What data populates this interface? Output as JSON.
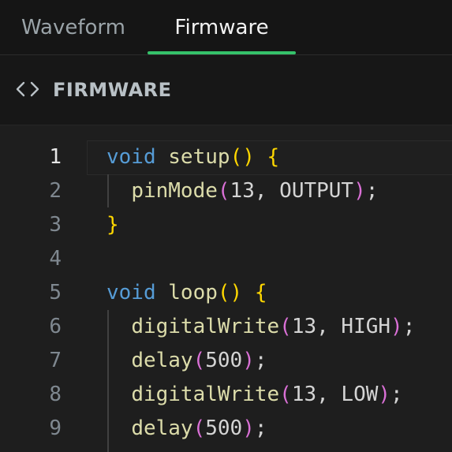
{
  "tabs": {
    "waveform": "Waveform",
    "firmware": "Firmware"
  },
  "section": {
    "icon": "code-icon",
    "title": "FIRMWARE"
  },
  "colors": {
    "active_tab_underline": "#35c26a",
    "keyword": "#569cd6",
    "function": "#dcdcaa",
    "bracket_level1": "#ffd700",
    "bracket_level2": "#da70d6",
    "text": "#d4d4d4",
    "line_number": "#7f8890"
  },
  "editor": {
    "active_line": 1,
    "lines": [
      {
        "number": "1",
        "tokens": [
          [
            "kw",
            "void"
          ],
          [
            "tx",
            " "
          ],
          [
            "fn",
            "setup"
          ],
          [
            "p1",
            "()"
          ],
          [
            "tx",
            " "
          ],
          [
            "p1",
            "{"
          ]
        ]
      },
      {
        "number": "2",
        "tokens": [
          [
            "tx",
            "  "
          ],
          [
            "fn",
            "pinMode"
          ],
          [
            "p2",
            "("
          ],
          [
            "tx",
            "13, OUTPUT"
          ],
          [
            "p2",
            ")"
          ],
          [
            "tx",
            ";"
          ]
        ]
      },
      {
        "number": "3",
        "tokens": [
          [
            "p1",
            "}"
          ]
        ]
      },
      {
        "number": "4",
        "tokens": []
      },
      {
        "number": "5",
        "tokens": [
          [
            "kw",
            "void"
          ],
          [
            "tx",
            " "
          ],
          [
            "fn",
            "loop"
          ],
          [
            "p1",
            "()"
          ],
          [
            "tx",
            " "
          ],
          [
            "p1",
            "{"
          ]
        ]
      },
      {
        "number": "6",
        "tokens": [
          [
            "tx",
            "  "
          ],
          [
            "fn",
            "digitalWrite"
          ],
          [
            "p2",
            "("
          ],
          [
            "tx",
            "13, HIGH"
          ],
          [
            "p2",
            ")"
          ],
          [
            "tx",
            ";"
          ]
        ]
      },
      {
        "number": "7",
        "tokens": [
          [
            "tx",
            "  "
          ],
          [
            "fn",
            "delay"
          ],
          [
            "p2",
            "("
          ],
          [
            "tx",
            "500"
          ],
          [
            "p2",
            ")"
          ],
          [
            "tx",
            ";"
          ]
        ]
      },
      {
        "number": "8",
        "tokens": [
          [
            "tx",
            "  "
          ],
          [
            "fn",
            "digitalWrite"
          ],
          [
            "p2",
            "("
          ],
          [
            "tx",
            "13, LOW"
          ],
          [
            "p2",
            ")"
          ],
          [
            "tx",
            ";"
          ]
        ]
      },
      {
        "number": "9",
        "tokens": [
          [
            "tx",
            "  "
          ],
          [
            "fn",
            "delay"
          ],
          [
            "p2",
            "("
          ],
          [
            "tx",
            "500"
          ],
          [
            "p2",
            ")"
          ],
          [
            "tx",
            ";"
          ]
        ]
      }
    ]
  }
}
